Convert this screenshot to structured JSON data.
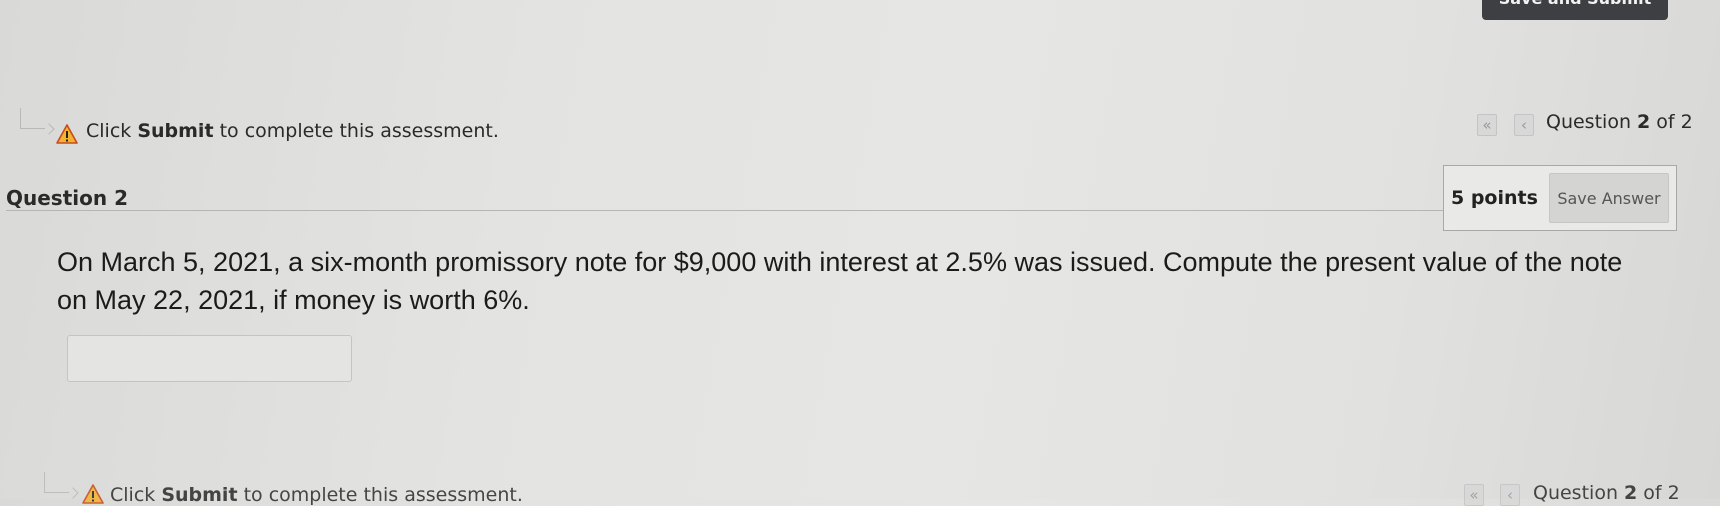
{
  "top_bar": {
    "submit_button_label": "Save and Submit"
  },
  "notice": {
    "prefix": "Click ",
    "bold": "Submit",
    "suffix": " to complete this assessment."
  },
  "navigation": {
    "first_icon": "«",
    "prev_icon": "‹",
    "counter_prefix": "Question ",
    "counter_current": "2",
    "counter_suffix": " of 2"
  },
  "question": {
    "title": "Question 2",
    "points": "5 points",
    "save_answer_label": "Save Answer",
    "text": "On March 5, 2021, a six-month promissory note for $9,000 with interest at 2.5% was issued. Compute the present value of the note on May 22, 2021, if money is worth 6%.",
    "answer_value": ""
  },
  "icons": {
    "warning": "warning-icon",
    "indent": "indent-arrow-icon"
  },
  "colors": {
    "warning_fill": "#f2b330",
    "warning_border": "#c94a1c",
    "top_button_bg": "#3d3f43"
  }
}
